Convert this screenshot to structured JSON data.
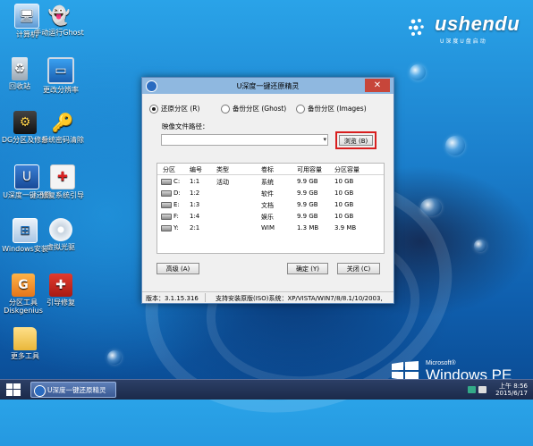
{
  "desktop": {
    "icons": [
      {
        "label": "计算机",
        "icon": "computer-icon"
      },
      {
        "label": "手动运行Ghost",
        "icon": "ghost-icon"
      },
      {
        "label": "回收站",
        "icon": "recycle-bin-icon"
      },
      {
        "label": "更改分辨率",
        "icon": "monitor-icon"
      },
      {
        "label": "DG分区及修分",
        "icon": "disk-genius-icon"
      },
      {
        "label": "系统密码清除",
        "icon": "key-icon"
      },
      {
        "label": "U深度一键还原",
        "icon": "ushendu-icon"
      },
      {
        "label": "修复系统引导",
        "icon": "first-aid-icon"
      },
      {
        "label": "Windows安装",
        "icon": "windows-install-icon"
      },
      {
        "label": "虚拟光驱",
        "icon": "virtual-drive-icon"
      },
      {
        "label": "分区工具Diskgenius",
        "icon": "diskgenius-tool-icon"
      },
      {
        "label": "引导修复",
        "icon": "toolbox-icon"
      },
      {
        "label": "更多工具",
        "icon": "folder-icon"
      }
    ],
    "logo": {
      "brand": "ushendu",
      "sub": "U深度U盘启动"
    },
    "winpe": {
      "ms": "Microsoft®",
      "name": "Windows PE"
    }
  },
  "dialog": {
    "title": "U深度一键还原精灵",
    "close": "✕",
    "radios": [
      {
        "label": "还原分区 (R)",
        "checked": true
      },
      {
        "label": "备份分区 (Ghost)",
        "checked": false
      },
      {
        "label": "备份分区 (Images)",
        "checked": false
      }
    ],
    "path_label": "映像文件路径：",
    "path_value": "",
    "browse": "浏览 (B)",
    "table": {
      "headers": [
        "分区",
        "编号",
        "类型",
        "卷标",
        "可用容量",
        "分区容量"
      ],
      "rows": [
        [
          "C:",
          "1:1",
          "活动",
          "系统",
          "9.9 GB",
          "10 GB"
        ],
        [
          "D:",
          "1:2",
          "",
          "软件",
          "9.9 GB",
          "10 GB"
        ],
        [
          "E:",
          "1:3",
          "",
          "文档",
          "9.9 GB",
          "10 GB"
        ],
        [
          "F:",
          "1:4",
          "",
          "娱乐",
          "9.9 GB",
          "10 GB"
        ],
        [
          "Y:",
          "2:1",
          "",
          "WIM",
          "1.3 MB",
          "3.9 MB"
        ]
      ]
    },
    "advanced": "高级 (A)",
    "ok": "确定 (Y)",
    "close_btn": "关闭 (C)",
    "version": "版本：3.1.15.316",
    "support": "支持安装原版(ISO)系统：XP/VISTA/WIN7/8/8.1/10/2003,"
  },
  "taskbar": {
    "item": "U深度一键还原精灵",
    "time": "上午 8:56",
    "date": "2015/6/17"
  }
}
